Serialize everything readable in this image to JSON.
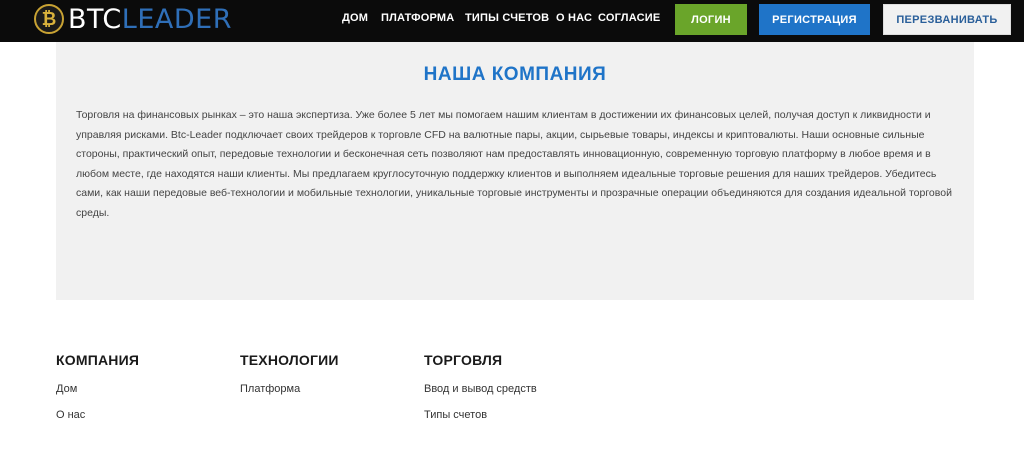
{
  "header": {
    "logo": {
      "btc": "BTC",
      "leader": "LEADER",
      "coin_symbol": "₿"
    },
    "nav": [
      "Дом",
      "Платформа",
      "Типы счетов",
      "О нас",
      "Согласие"
    ],
    "buttons": {
      "login": "Логин",
      "register": "Регистрация",
      "callback": "Перезванивать"
    }
  },
  "company": {
    "title": "НАША КОМПАНИЯ",
    "text": "Торговля на финансовых рынках – это наша экспертиза. Уже более 5 лет мы помогаем нашим клиентам в достижении их финансовых целей, получая доступ к ликвидности и управляя рисками. Btc-Leader подключает своих трейдеров к торговле CFD на валютные пары, акции, сырьевые товары, индексы и криптовалюты. Наши основные сильные стороны, практический опыт, передовые технологии и бесконечная сеть позволяют нам предоставлять инновационную, современную торговую платформу в любое время и в любом месте, где находятся наши клиенты. Мы предлагаем круглосуточную поддержку клиентов и выполняем идеальные торговые решения для наших трейдеров. Убедитесь сами, как наши передовые веб-технологии и мобильные технологии, уникальные торговые инструменты и прозрачные операции объединяются для создания идеальной торговой среды."
  },
  "footer": {
    "columns": [
      {
        "heading": "Компания",
        "links": [
          "Дом",
          "О нас"
        ]
      },
      {
        "heading": "Технологии",
        "links": [
          "Платформа"
        ]
      },
      {
        "heading": "Торговля",
        "links": [
          "Ввод и вывод средств",
          "Типы счетов"
        ]
      }
    ]
  },
  "colors": {
    "header_bg": "#0b0b0b",
    "brand_blue": "#1f74c8",
    "login_green": "#6aa52a",
    "section_bg": "#f1f1f1",
    "logo_gold": "#c8a233"
  }
}
